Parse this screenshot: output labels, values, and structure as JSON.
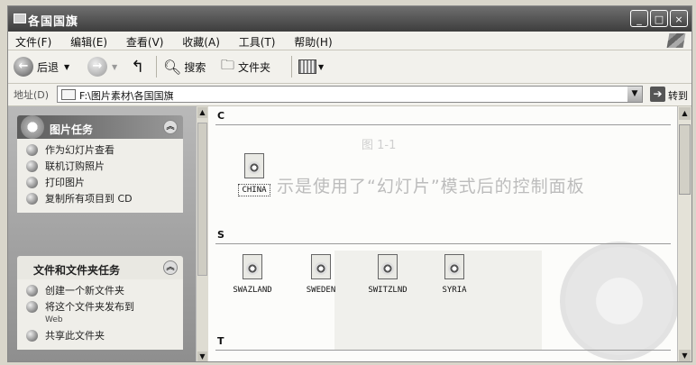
{
  "window": {
    "title": "各国国旗"
  },
  "window_buttons": {
    "minimize": "_",
    "maximize": "□",
    "close": "×"
  },
  "menu": [
    "文件(F)",
    "编辑(E)",
    "查看(V)",
    "收藏(A)",
    "工具(T)",
    "帮助(H)"
  ],
  "toolbar": {
    "back": "后退",
    "search": "搜索",
    "folders": "文件夹"
  },
  "address": {
    "label": "地址(D)",
    "path": "F:\\图片素材\\各国国旗",
    "go": "转到"
  },
  "tasks_panel": {
    "title": "图片任务",
    "items": [
      "作为幻灯片查看",
      "联机订购照片",
      "打印图片",
      "复制所有项目到 CD"
    ]
  },
  "folder_panel": {
    "title": "文件和文件夹任务",
    "items": [
      {
        "label": "创建一个新文件夹"
      },
      {
        "label": "将这个文件夹发布到",
        "sub": "Web"
      },
      {
        "label": "共享此文件夹"
      }
    ]
  },
  "groups": [
    {
      "letter": "C",
      "files": [
        "CHINA"
      ]
    },
    {
      "letter": "S",
      "files": [
        "SWAZLAND",
        "SWEDEN",
        "SWITZLND",
        "SYRIA"
      ]
    },
    {
      "letter": "T",
      "files": []
    }
  ],
  "background_ghost_text": "示是使用了“幻灯片”模式后的控制面板",
  "background_ghost_small": "图 1-1"
}
